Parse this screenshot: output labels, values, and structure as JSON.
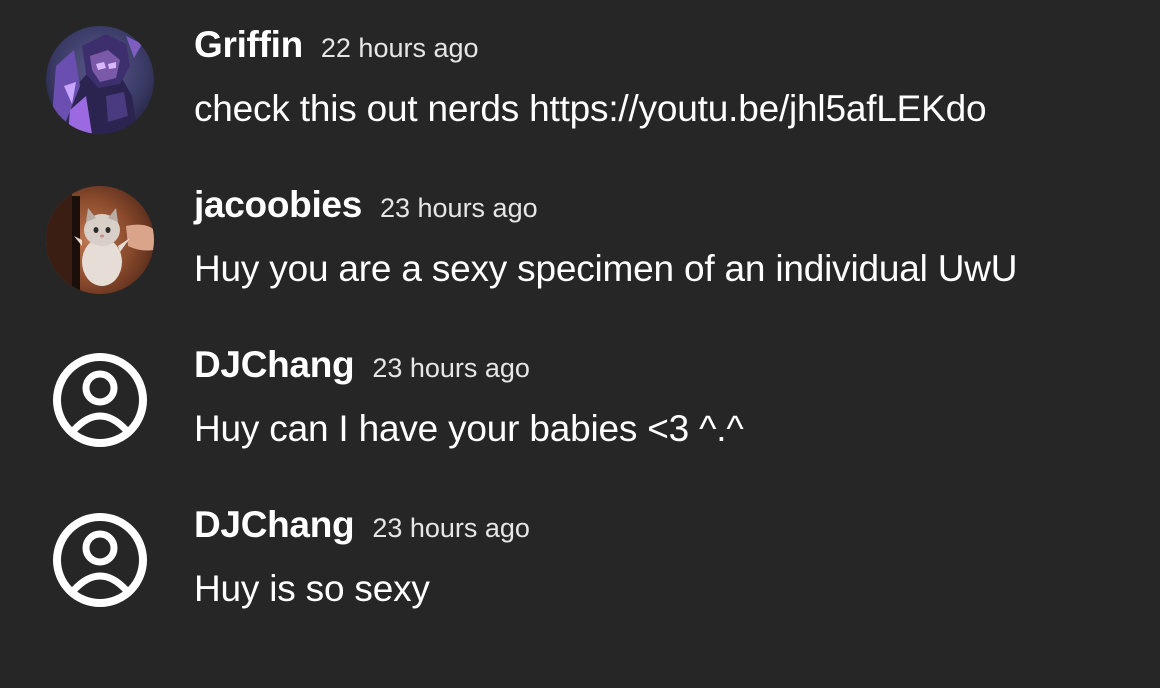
{
  "comments": [
    {
      "username": "Griffin",
      "timestamp": "22 hours ago",
      "text": "check this out nerds https://youtu.be/jhl5afLEKdo",
      "avatar_icon": "character-avatar"
    },
    {
      "username": "jacoobies",
      "timestamp": "23 hours ago",
      "text": "Huy you are a sexy specimen of an individual UwU",
      "avatar_icon": "cat-photo-avatar"
    },
    {
      "username": "DJChang",
      "timestamp": "23 hours ago",
      "text": "Huy can I have your babies <3 ^.^",
      "avatar_icon": "default-user-icon"
    },
    {
      "username": "DJChang",
      "timestamp": "23 hours ago",
      "text": "Huy is so sexy",
      "avatar_icon": "default-user-icon"
    }
  ],
  "colors": {
    "background": "#262626",
    "text": "#ffffff",
    "timestamp": "#e6e6e6"
  }
}
